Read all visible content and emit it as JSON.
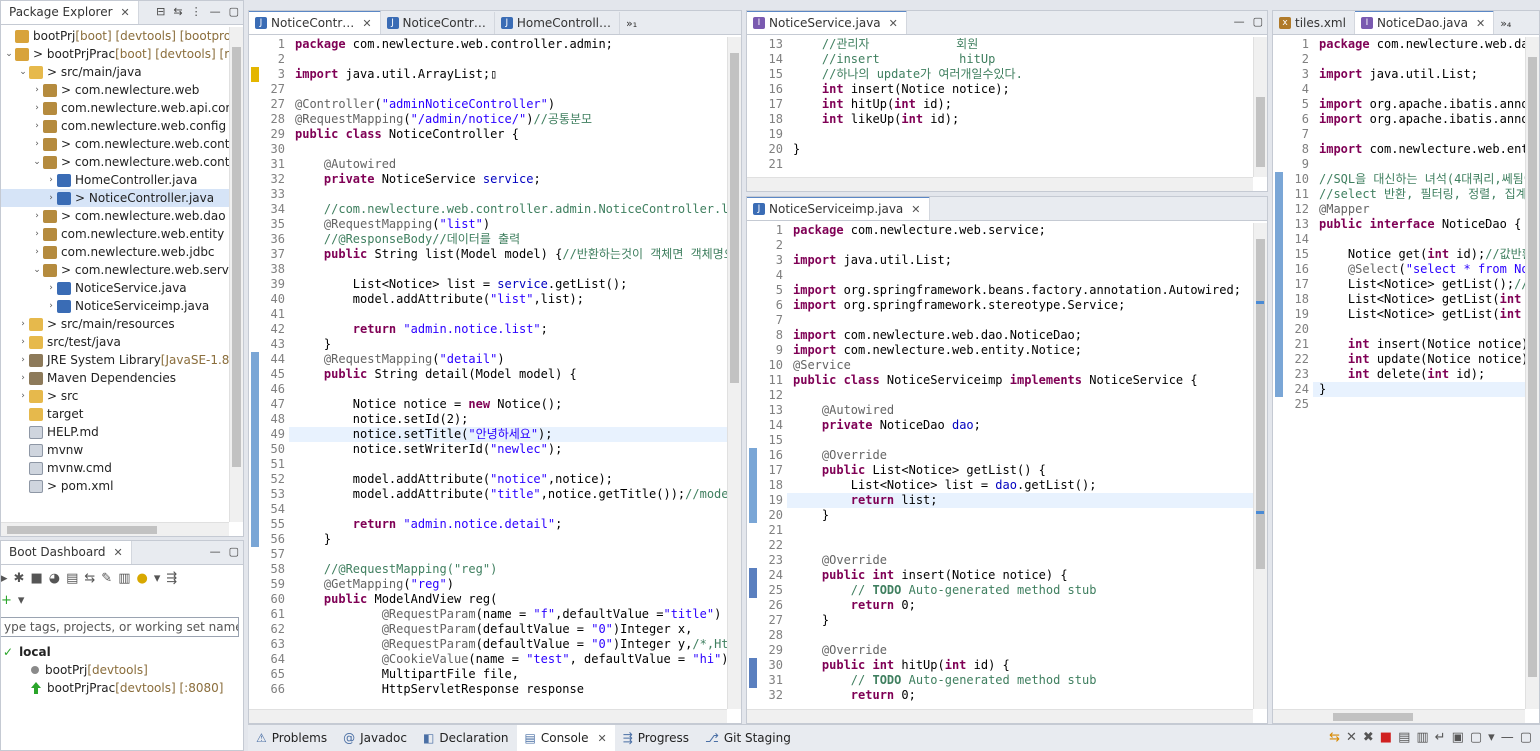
{
  "package_explorer": {
    "title": "Package Explorer",
    "items": [
      {
        "exp": "",
        "icon": "proj",
        "label": "bootPrj",
        "suffix": " [boot] [devtools] [bootprojec",
        "indent": 0
      },
      {
        "exp": "⌄",
        "icon": "proj",
        "label": "> bootPrjPrac",
        "suffix": " [boot] [devtools] [repo",
        "indent": 0
      },
      {
        "exp": "⌄",
        "icon": "folder",
        "label": "> src/main/java",
        "suffix": "",
        "indent": 1
      },
      {
        "exp": "›",
        "icon": "pkg",
        "label": "> com.newlecture.web",
        "suffix": "",
        "indent": 2
      },
      {
        "exp": "›",
        "icon": "pkg",
        "label": "com.newlecture.web.api.contro",
        "suffix": "",
        "indent": 2
      },
      {
        "exp": "›",
        "icon": "pkg",
        "label": "com.newlecture.web.config",
        "suffix": "",
        "indent": 2
      },
      {
        "exp": "›",
        "icon": "pkg",
        "label": "> com.newlecture.web.controll",
        "suffix": "",
        "indent": 2
      },
      {
        "exp": "⌄",
        "icon": "pkg",
        "label": "> com.newlecture.web.controll",
        "suffix": "",
        "indent": 2
      },
      {
        "exp": "›",
        "icon": "java",
        "label": "HomeController.java",
        "suffix": "",
        "indent": 3
      },
      {
        "exp": "›",
        "icon": "java",
        "label": "> NoticeController.java",
        "suffix": "",
        "indent": 3,
        "selected": true
      },
      {
        "exp": "›",
        "icon": "pkg",
        "label": "> com.newlecture.web.dao",
        "suffix": "",
        "indent": 2
      },
      {
        "exp": "›",
        "icon": "pkg",
        "label": "com.newlecture.web.entity",
        "suffix": "",
        "indent": 2
      },
      {
        "exp": "›",
        "icon": "pkg",
        "label": "com.newlecture.web.jdbc",
        "suffix": "",
        "indent": 2
      },
      {
        "exp": "⌄",
        "icon": "pkg",
        "label": "> com.newlecture.web.service",
        "suffix": "",
        "indent": 2
      },
      {
        "exp": "›",
        "icon": "java",
        "label": "NoticeService.java",
        "suffix": "",
        "indent": 3
      },
      {
        "exp": "›",
        "icon": "java",
        "label": "NoticeServiceimp.java",
        "suffix": "",
        "indent": 3
      },
      {
        "exp": "›",
        "icon": "folder",
        "label": "> src/main/resources",
        "suffix": "",
        "indent": 1
      },
      {
        "exp": "›",
        "icon": "folder",
        "label": "src/test/java",
        "suffix": "",
        "indent": 1
      },
      {
        "exp": "›",
        "icon": "jar",
        "label": "JRE System Library",
        "suffix": " [JavaSE-1.8]",
        "indent": 1
      },
      {
        "exp": "›",
        "icon": "jar",
        "label": "Maven Dependencies",
        "suffix": "",
        "indent": 1
      },
      {
        "exp": "›",
        "icon": "folder",
        "label": "> src",
        "suffix": "",
        "indent": 1
      },
      {
        "exp": "",
        "icon": "folder",
        "label": "target",
        "suffix": "",
        "indent": 1
      },
      {
        "exp": "",
        "icon": "file",
        "label": "HELP.md",
        "suffix": "",
        "indent": 1
      },
      {
        "exp": "",
        "icon": "file",
        "label": "mvnw",
        "suffix": "",
        "indent": 1
      },
      {
        "exp": "",
        "icon": "file",
        "label": "mvnw.cmd",
        "suffix": "",
        "indent": 1
      },
      {
        "exp": "",
        "icon": "file",
        "label": "> pom.xml",
        "suffix": "",
        "indent": 1
      }
    ]
  },
  "boot_dashboard": {
    "title": "Boot Dashboard",
    "filter_placeholder": "ype tags, projects, or working set names to",
    "local": "local",
    "apps": [
      {
        "name": "bootPrj",
        "suffix": " [devtools]",
        "running": false
      },
      {
        "name": "bootPrjPrac",
        "suffix": " [devtools] [:8080]",
        "running": true
      }
    ]
  },
  "editor_left": {
    "tabs": [
      "NoticeContr…",
      "NoticeContr…",
      "HomeControll…"
    ],
    "more": "»₁",
    "lines": [
      [
        "1",
        "<span class=kw>package</span> com.newlecture.web.controller.admin;"
      ],
      [
        "2",
        ""
      ],
      [
        "3",
        "<span class=kw>import</span> java.util.ArrayList;▯"
      ],
      [
        "27",
        ""
      ],
      [
        "27",
        "<span class=an>@Controller</span>(<span class=st>\"adminNoticeController\"</span>)"
      ],
      [
        "28",
        "<span class=an>@RequestMapping</span>(<span class=st>\"/admin/notice/\"</span>)<span class=cm>//공통분모</span>"
      ],
      [
        "29",
        "<span class=kw>public class</span> NoticeController {"
      ],
      [
        "30",
        ""
      ],
      [
        "31",
        "    <span class=an>@Autowired</span>"
      ],
      [
        "32",
        "    <span class=kw>private</span> NoticeService <span class=fd>service</span>;"
      ],
      [
        "33",
        ""
      ],
      [
        "34",
        "    <span class=cm>//com.newlecture.web.controller.admin.NoticeController.l</span>"
      ],
      [
        "35",
        "    <span class=an>@RequestMapping</span>(<span class=st>\"list\"</span>)"
      ],
      [
        "36",
        "    <span class=cm>//@ResponseBody//데이터를 출력</span>"
      ],
      [
        "37",
        "    <span class=kw>public</span> String list(Model model) {<span class=cm>//반환하는것이 객체면 객체명으</span>"
      ],
      [
        "38",
        ""
      ],
      [
        "39",
        "        List&lt;Notice&gt; list = <span class=fd>service</span>.getList();"
      ],
      [
        "40",
        "        model.addAttribute(<span class=st>\"list\"</span>,list);"
      ],
      [
        "41",
        ""
      ],
      [
        "42",
        "        <span class=kw>return</span> <span class=st>\"admin.notice.list\"</span>;"
      ],
      [
        "43",
        "    }"
      ],
      [
        "44",
        "    <span class=an>@RequestMapping</span>(<span class=st>\"detail\"</span>)"
      ],
      [
        "45",
        "    <span class=kw>public</span> String detail(Model model) {"
      ],
      [
        "46",
        ""
      ],
      [
        "47",
        "        Notice notice = <span class=kw>new</span> Notice();"
      ],
      [
        "48",
        "        notice.setId(2);"
      ],
      [
        "49",
        "        notice.setTitle(<span class=st>\"안녕하세요\"</span>);"
      ],
      [
        "50",
        "        notice.setWriterId(<span class=st>\"newlec\"</span>);"
      ],
      [
        "51",
        ""
      ],
      [
        "52",
        "        model.addAttribute(<span class=st>\"notice\"</span>,notice);"
      ],
      [
        "53",
        "        model.addAttribute(<span class=st>\"title\"</span>,notice.getTitle());<span class=cm>//mode</span>"
      ],
      [
        "54",
        ""
      ],
      [
        "55",
        "        <span class=kw>return</span> <span class=st>\"admin.notice.detail\"</span>;"
      ],
      [
        "56",
        "    }"
      ],
      [
        "57",
        ""
      ],
      [
        "58",
        "    <span class=cm>//@RequestMapping(\"reg\")</span>"
      ],
      [
        "59",
        "    <span class=an>@GetMapping</span>(<span class=st>\"reg\"</span>)"
      ],
      [
        "60",
        "    <span class=kw>public</span> ModelAndView reg("
      ],
      [
        "61",
        "            <span class=an>@RequestParam</span>(name = <span class=st>\"f\"</span>,defaultValue =<span class=st>\"title\"</span>)"
      ],
      [
        "62",
        "            <span class=an>@RequestParam</span>(defaultValue = <span class=st>\"0\"</span>)Integer x,"
      ],
      [
        "63",
        "            <span class=an>@RequestParam</span>(defaultValue = <span class=st>\"0\"</span>)Integer y,<span class=cm>/*,Ht</span>"
      ],
      [
        "64",
        "            <span class=an>@CookieValue</span>(name = <span class=st>\"test\"</span>, defaultValue = <span class=st>\"hi\"</span>)"
      ],
      [
        "65",
        "            MultipartFile file,"
      ],
      [
        "66",
        "            HttpServletResponse response"
      ]
    ]
  },
  "editor_service": {
    "tab": "NoticeService.java",
    "lines": [
      [
        "13",
        "    <span class=cm>//관리자            회원</span>"
      ],
      [
        "14",
        "    <span class=cm>//insert           hitUp</span>"
      ],
      [
        "15",
        "    <span class=cm>//하나의 update가 여러개일수있다.</span>"
      ],
      [
        "16",
        "    <span class=kw>int</span> insert(Notice notice);"
      ],
      [
        "17",
        "    <span class=kw>int</span> hitUp(<span class=kw>int</span> id);"
      ],
      [
        "18",
        "    <span class=kw>int</span> likeUp(<span class=kw>int</span> id);"
      ],
      [
        "19",
        ""
      ],
      [
        "20",
        "}"
      ],
      [
        "21",
        ""
      ]
    ]
  },
  "editor_serviceimp": {
    "tab": "NoticeServiceimp.java",
    "lines": [
      [
        "1",
        "<span class=kw>package</span> com.newlecture.web.service;"
      ],
      [
        "2",
        ""
      ],
      [
        "3",
        "<span class=kw>import</span> java.util.List;"
      ],
      [
        "4",
        ""
      ],
      [
        "5",
        "<span class=kw>import</span> org.springframework.beans.factory.annotation.Autowired;"
      ],
      [
        "6",
        "<span class=kw>import</span> org.springframework.stereotype.Service;"
      ],
      [
        "7",
        ""
      ],
      [
        "8",
        "<span class=kw>import</span> com.newlecture.web.dao.NoticeDao;"
      ],
      [
        "9",
        "<span class=kw>import</span> com.newlecture.web.entity.Notice;"
      ],
      [
        "10",
        "<span class=an>@Service</span>"
      ],
      [
        "11",
        "<span class=kw>public class</span> NoticeServiceimp <span class=kw>implements</span> NoticeService {"
      ],
      [
        "12",
        ""
      ],
      [
        "13",
        "    <span class=an>@Autowired</span>"
      ],
      [
        "14",
        "    <span class=kw>private</span> NoticeDao <span class=fd>dao</span>;"
      ],
      [
        "15",
        ""
      ],
      [
        "16",
        "    <span class=an>@Override</span>"
      ],
      [
        "17",
        "    <span class=kw>public</span> List&lt;Notice&gt; getList() {"
      ],
      [
        "18",
        "        List&lt;Notice&gt; list = <span class=fd>dao</span>.getList();"
      ],
      [
        "19",
        "        <span class=kw>return</span> list;"
      ],
      [
        "20",
        "    }"
      ],
      [
        "21",
        ""
      ],
      [
        "22",
        ""
      ],
      [
        "23",
        "    <span class=an>@Override</span>"
      ],
      [
        "24",
        "    <span class=kw>public int</span> insert(Notice notice) {"
      ],
      [
        "25",
        "        <span class=cm>// <b>TODO</b> Auto-generated method stub</span>"
      ],
      [
        "26",
        "        <span class=kw>return</span> 0;"
      ],
      [
        "27",
        "    }"
      ],
      [
        "28",
        ""
      ],
      [
        "29",
        "    <span class=an>@Override</span>"
      ],
      [
        "30",
        "    <span class=kw>public int</span> hitUp(<span class=kw>int</span> id) {"
      ],
      [
        "31",
        "        <span class=cm>// <b>TODO</b> Auto-generated method stub</span>"
      ],
      [
        "32",
        "        <span class=kw>return</span> 0;"
      ]
    ]
  },
  "editor_right": {
    "tabs": [
      "tiles.xml",
      "NoticeDao.java"
    ],
    "more": "»₄",
    "lines": [
      [
        "1",
        "<span class=kw>package</span> com.newlecture.web.dao"
      ],
      [
        "2",
        ""
      ],
      [
        "3",
        "<span class=kw>import</span> java.util.List;"
      ],
      [
        "4",
        ""
      ],
      [
        "5",
        "<span class=kw>import</span> org.apache.ibatis.annot"
      ],
      [
        "6",
        "<span class=kw>import</span> org.apache.ibatis.annot"
      ],
      [
        "7",
        ""
      ],
      [
        "8",
        "<span class=kw>import</span> com.newlecture.web.enti"
      ],
      [
        "9",
        ""
      ],
      [
        "10",
        "<span class=cm>//SQL을 대신하는 녀석(4대쿼리,쎄됨이 </span>"
      ],
      [
        "11",
        "<span class=cm>//select 반환, 필터링, 정렬, 집계,.</span>"
      ],
      [
        "12",
        "<span class=an>@Mapper</span>"
      ],
      [
        "13",
        "<span class=kw>public interface</span> NoticeDao {"
      ],
      [
        "14",
        ""
      ],
      [
        "15",
        "    Notice get(<span class=kw>int</span> id);<span class=cm>//값반환</span>"
      ],
      [
        "16",
        "    <span class=an>@Select</span>(<span class=st>\"select * from Not</span>"
      ],
      [
        "17",
        "    List&lt;Notice&gt; getList();<span class=cm>//목</span>"
      ],
      [
        "18",
        "    List&lt;Notice&gt; getList(<span class=kw>int</span> p"
      ],
      [
        "19",
        "    List&lt;Notice&gt; getList(<span class=kw>int</span> p"
      ],
      [
        "20",
        ""
      ],
      [
        "21",
        "    <span class=kw>int</span> insert(Notice notice);"
      ],
      [
        "22",
        "    <span class=kw>int</span> update(Notice notice);"
      ],
      [
        "23",
        "    <span class=kw>int</span> delete(<span class=kw>int</span> id);"
      ],
      [
        "24",
        "}"
      ],
      [
        "25",
        ""
      ]
    ]
  },
  "bottom": {
    "tabs": [
      "Problems",
      "Javadoc",
      "Declaration",
      "Console",
      "Progress",
      "Git Staging"
    ],
    "active": "Console"
  }
}
